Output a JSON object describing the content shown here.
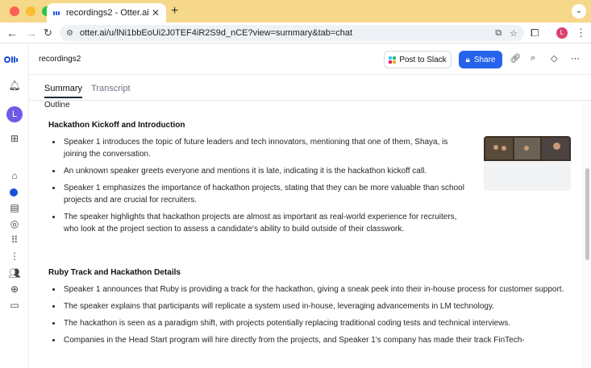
{
  "browser": {
    "tab_title": "recordings2 - Otter.ai",
    "tab_close": "✕",
    "new_tab": "+",
    "url": "otter.ai/u/lNi1bbEoUi2J0TEF4iR2S9d_nCE?view=summary&tab=chat",
    "profile_initial": "L"
  },
  "app": {
    "doc_title": "recordings2",
    "post_to_slack": "Post to Slack",
    "share": "Share",
    "user_initial": "L"
  },
  "tabs": {
    "summary": "Summary",
    "transcript": "Transcript"
  },
  "content": {
    "outline_label": "Outline",
    "sections": [
      {
        "title": "Hackathon Kickoff and Introduction",
        "bullets": [
          "Speaker 1 introduces the topic of future leaders and tech innovators, mentioning that one of them, Shaya, is joining the conversation.",
          "An unknown speaker greets everyone and mentions it is late, indicating it is the hackathon kickoff call.",
          "Speaker 1 emphasizes the importance of hackathon projects, stating that they can be more valuable than school projects and are crucial for recruiters.",
          "The speaker highlights that hackathon projects are almost as important as real-world experience for recruiters, who look at the project section to assess a candidate's ability to build outside of their classwork."
        ]
      },
      {
        "title": "Ruby Track and Hackathon Details",
        "bullets": [
          "Speaker 1 announces that Ruby is providing a track for the hackathon, giving a sneak peek into their in-house process for customer support.",
          "The speaker explains that participants will replicate a system used in-house, leveraging advancements in LM technology.",
          "The hackathon is seen as a paradigm shift, with projects potentially replacing traditional coding tests and technical interviews.",
          "Companies in the Head Start program will hire directly from the projects, and Speaker 1's company has made their track FinTech-"
        ]
      }
    ]
  },
  "colors": {
    "accent": "#2563eb",
    "tabbar": "#f6d88a",
    "avatar": "#6d5ae6"
  },
  "icons": [
    "bell-icon",
    "add-conversation-icon",
    "home-icon",
    "notes-icon",
    "apps-icon",
    "more-vertical-icon",
    "people-icon",
    "folder-icon",
    "link-icon",
    "search-icon",
    "gem-icon",
    "more-horizontal-icon"
  ]
}
